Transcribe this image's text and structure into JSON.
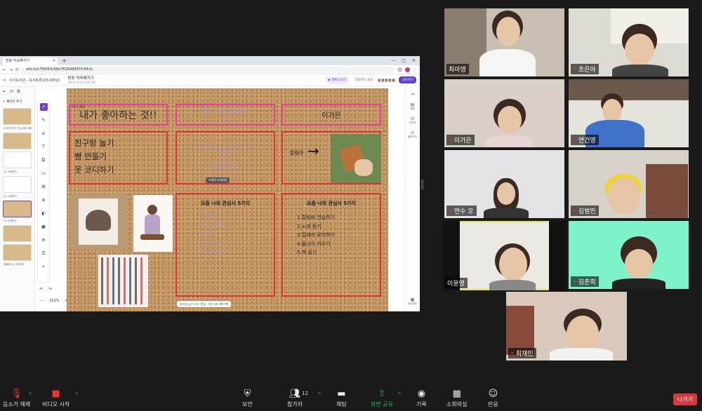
{
  "browser": {
    "tab_title": "방포 익숙해지기",
    "tab_close": "×",
    "new_tab": "+",
    "url": "allo.io/c7fb093c68a7626d8497fc44cb",
    "window_controls": [
      "—",
      "□",
      "✕"
    ]
  },
  "app": {
    "breadcrumb_home": "⌂",
    "breadcrumb": "이사도서관 - 독서토론(초5-6학년)",
    "board_title": "방포 익숙해지기",
    "board_subtitle": "이가은 이사도서관 이하",
    "btn_present": "▶ 캔버스보기",
    "btn_record": "고정하는 요리",
    "btn_share": "공유하기",
    "panel_icons": [
      "⇤",
      "⊡",
      "⧉"
    ],
    "add_page": "+ 페이지 추가",
    "thumb_captions": [
      "내 취미 또는 관심사에 대해",
      "나! 소개하기",
      "나! 소개하기",
      "나! 소개하기",
      "동물을 나! 소개하기"
    ],
    "undo": "↶",
    "redo": "↷",
    "zoom_out": "−",
    "zoom_level": "101%",
    "zoom_in": "+",
    "tools": [
      "➚",
      "✎",
      "⌀",
      "T",
      "⧉",
      "▭",
      "⊞",
      "⧈",
      "◐",
      "▣",
      "⊕",
      "☰",
      "+"
    ],
    "right_items": [
      {
        "icon": "⇥",
        "label": ""
      },
      {
        "icon": "▤",
        "label": "채팅"
      },
      {
        "icon": "⊡",
        "label": "진도판"
      },
      {
        "icon": "⊙",
        "label": "플레이어"
      },
      {
        "icon": "▦",
        "label": "화상회의"
      }
    ]
  },
  "board": {
    "page_label": "이ㅏ20",
    "title1": "내가 좋아하는 것!!",
    "title2": "한인 · 나의 좋아하는 것",
    "title3": "이가은",
    "list1": [
      "친구랑 놀기",
      "빵 만들기",
      "옷 코디하기"
    ],
    "faded2": [
      "음악 듣기 하는 노래가나 악기를 보는",
      "문화재 보기",
      "책 읽기",
      "이벤트 하기"
    ],
    "kalimba_label": "칼림바",
    "arrow": "→",
    "tooltip": "조재민 (비회원)",
    "interests_head": "요즘 나의 관심사 5가지",
    "faded_interests": [
      "운동하기",
      "가수 노래 듣기",
      "요리하기",
      "피아노 치기",
      "친구와 놀기"
    ],
    "interests": [
      "1.칼림바 연습하기",
      "2.노래 듣기",
      "3.집에서 요리하기",
      "4.물고기 키우기",
      "5.책 읽기"
    ],
    "status": "최아영 님이 보드 편집 · 4분 4초 AM PM"
  },
  "participants": [
    {
      "name": "최아영",
      "muted": false
    },
    {
      "name": "조은아",
      "muted": true
    },
    {
      "name": "이가은",
      "muted": true
    },
    {
      "name": "연건영",
      "muted": true
    },
    {
      "name": "연수 오",
      "muted": true
    },
    {
      "name": "김범민",
      "muted": true
    },
    {
      "name": "이윤영",
      "muted": false
    },
    {
      "name": "김준희",
      "muted": true
    },
    {
      "name": "최채민",
      "muted": true
    }
  ],
  "controls": {
    "unmute": "음소거 해제",
    "video": "비디오 시작",
    "security": "보안",
    "participants": "참가자",
    "participant_count": "12",
    "chat": "채팅",
    "share": "화면 공유",
    "record": "기록",
    "breakout": "소회의실",
    "reactions": "반응",
    "leave": "나가기",
    "caret": "^"
  },
  "colors": {
    "cork": "#c89a67",
    "pink_border": "#e6409a",
    "red_border": "#e03232",
    "share_green": "#1fb64a",
    "leave_red": "#d43b3b",
    "speaker_yellow": "#e2e45b"
  }
}
